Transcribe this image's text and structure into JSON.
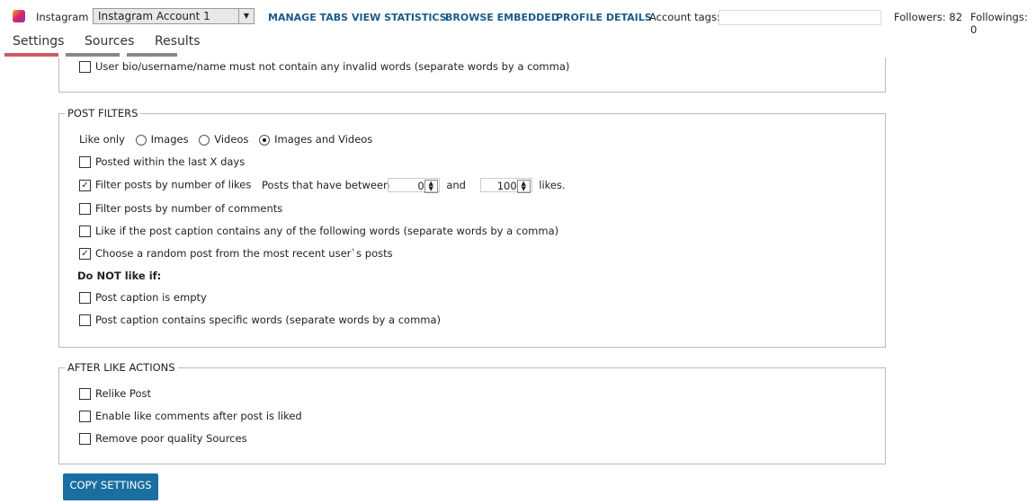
{
  "header": {
    "app": "Instagram",
    "account": "Instagram Account 1",
    "links": [
      "MANAGE TABS",
      "VIEW STATISTICS",
      "BROWSE EMBEDDED",
      "PROFILE DETAILS"
    ],
    "tags_label": "Account tags:",
    "tags_value": "",
    "followers": "Followers: 82",
    "followings": "Followings: 0"
  },
  "tabs": [
    "Settings",
    "Sources",
    "Results"
  ],
  "top": {
    "bio": "User bio/username/name must not contain any invalid words (separate words by a comma)"
  },
  "post": {
    "title": "POST FILTERS",
    "like_only": "Like only",
    "radios": [
      "Images",
      "Videos",
      "Images and Videos"
    ],
    "selected": "Images and Videos",
    "posted": "Posted within the last X days",
    "likes": "Filter posts by number of likes",
    "between": "Posts that have between",
    "min": "0",
    "and": "and",
    "max": "100",
    "likes_suffix": "likes.",
    "comments": "Filter posts by number of comments",
    "caption": "Like if the post caption contains any of the following words (separate words by a comma)",
    "random": "Choose a random post from the most recent user`s posts",
    "notlike": "Do NOT like if:",
    "empty": "Post caption is empty",
    "specific": "Post caption contains specific words (separate words by a comma)"
  },
  "after": {
    "title": "AFTER LIKE ACTIONS",
    "items": [
      "Relike Post",
      "Enable like comments after post is liked",
      "Remove poor quality Sources"
    ]
  },
  "copy": "COPY SETTINGS",
  "colors": {
    "accent": "#1a6fa0",
    "tab_active": "#d05a60"
  }
}
